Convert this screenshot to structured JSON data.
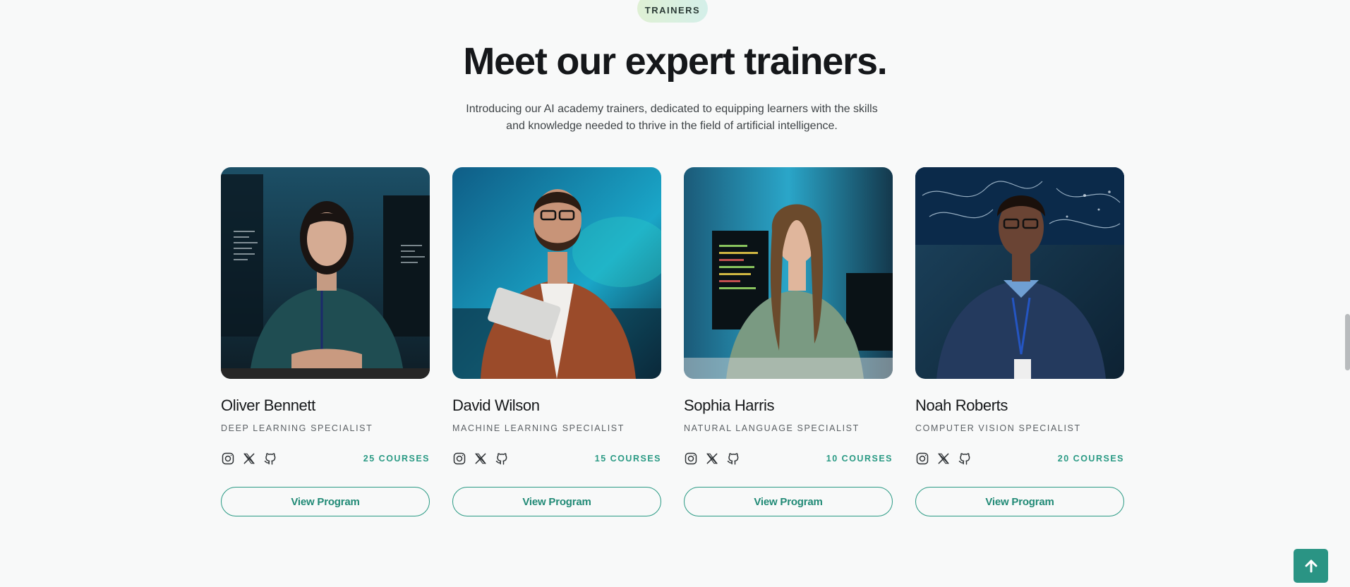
{
  "section": {
    "eyebrow": "TRAINERS",
    "title": "Meet our expert trainers.",
    "subtitle": "Introducing our AI academy trainers, dedicated to equipping learners with the skills and knowledge needed to thrive in the field of artificial intelligence."
  },
  "trainers": [
    {
      "name": "Oliver Bennett",
      "role": "DEEP LEARNING SPECIALIST",
      "courses": "25 COURSES",
      "button": "View Program"
    },
    {
      "name": "David Wilson",
      "role": "MACHINE LEARNING SPECIALIST",
      "courses": "15 COURSES",
      "button": "View Program"
    },
    {
      "name": "Sophia Harris",
      "role": "NATURAL LANGUAGE SPECIALIST",
      "courses": "10 COURSES",
      "button": "View Program"
    },
    {
      "name": "Noah Roberts",
      "role": "COMPUTER VISION SPECIALIST",
      "courses": "20 COURSES",
      "button": "View Program"
    }
  ],
  "social_icons": [
    "instagram-icon",
    "x-icon",
    "github-icon"
  ],
  "colors": {
    "accent": "#2a9a84",
    "background": "#f8f9f9",
    "scroll_button": "#2a9484"
  }
}
